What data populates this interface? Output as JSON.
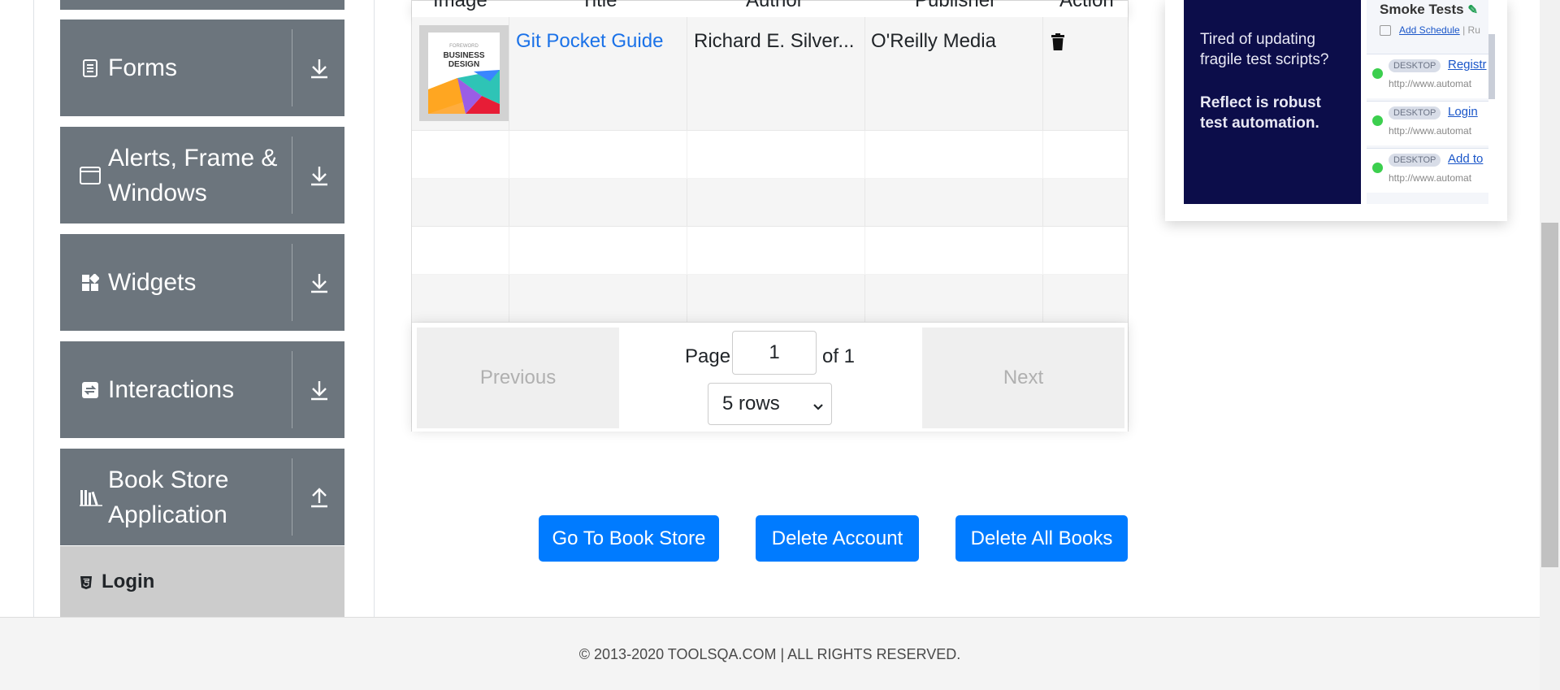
{
  "sidebar": {
    "groups": [
      {
        "label": "Forms",
        "icon": "file-icon",
        "arrow": "download-arrow-icon"
      },
      {
        "label": "Alerts, Frame & Windows",
        "icon": "window-icon",
        "arrow": "download-arrow-icon"
      },
      {
        "label": "Widgets",
        "icon": "widgets-icon",
        "arrow": "download-arrow-icon"
      },
      {
        "label": "Interactions",
        "icon": "interactions-icon",
        "arrow": "download-arrow-icon"
      },
      {
        "label": "Book Store Application",
        "icon": "books-icon",
        "arrow": "upload-arrow-icon"
      }
    ],
    "active_item": {
      "label": "Login",
      "icon": "html5-icon"
    }
  },
  "table": {
    "columns": [
      "Image",
      "Title",
      "Author",
      "Publisher",
      "Action"
    ],
    "rows": [
      {
        "title": "Git Pocket Guide",
        "author": "Richard E. Silver...",
        "publisher": "O'Reilly Media",
        "cover_text": "BUSINESS DESIGN",
        "action_icon": "trash-icon"
      }
    ]
  },
  "pagination": {
    "previous_label": "Previous",
    "next_label": "Next",
    "page_label": "Page",
    "page_value": "1",
    "of_label": "of 1",
    "rows_select": "5 rows"
  },
  "actions": {
    "go_to_store": "Go To Book Store",
    "delete_account": "Delete Account",
    "delete_all_books": "Delete All Books"
  },
  "ad": {
    "line1": "Tired of updating fragile test scripts?",
    "line2": "Reflect is robust test automation.",
    "panel_title": "Smoke Tests",
    "add_schedule": "Add Schedule",
    "sep": "| Ru",
    "items": [
      {
        "badge": "DESKTOP",
        "link": "Registr",
        "url": "http://www.automat"
      },
      {
        "badge": "DESKTOP",
        "link": "Login",
        "url": "http://www.automat"
      },
      {
        "badge": "DESKTOP",
        "link": "Add to",
        "url": "http://www.automat"
      }
    ]
  },
  "footer": {
    "text": "© 2013-2020 TOOLSQA.COM | ALL RIGHTS RESERVED."
  },
  "colors": {
    "primary": "#007bff",
    "sidebar": "#6c757d",
    "link": "#1b72e8",
    "ad_dark": "#0c0d4a"
  }
}
